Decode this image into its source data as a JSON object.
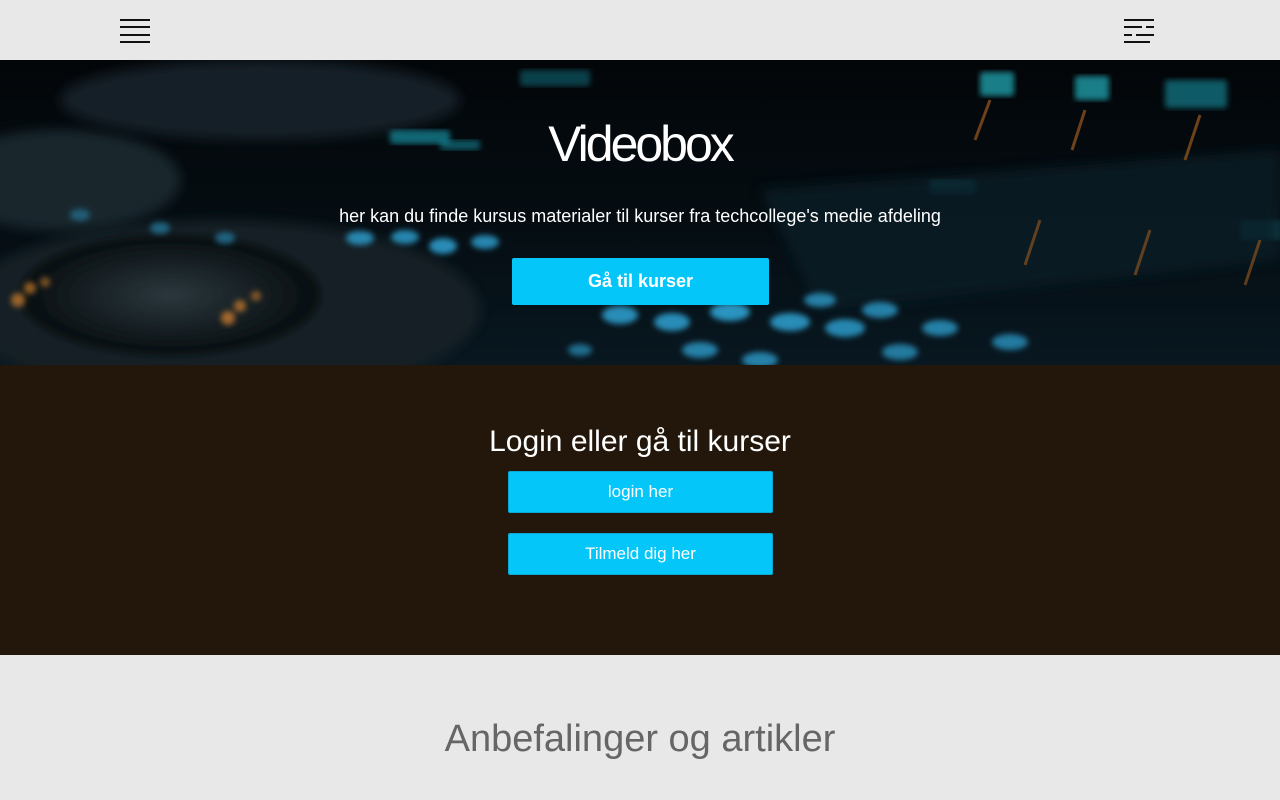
{
  "nav": {
    "menu_icon": "hamburger-menu-icon",
    "filter_icon": "filter-sliders-icon"
  },
  "hero": {
    "title": "Videobox",
    "subtitle": "her kan du finde kursus materialer til kurser fra techcollege's medie afdeling",
    "button_label": "Gå til kurser"
  },
  "login": {
    "heading": "Login eller gå til kurser",
    "login_label": "login her",
    "signup_label": "Tilmeld dig her"
  },
  "articles": {
    "heading": "Anbefalinger og artikler"
  },
  "colors": {
    "accent": "#05c6f9",
    "topbar": "#e8e8e8",
    "login_bg": "#22170a",
    "heading_grey": "#666666"
  }
}
